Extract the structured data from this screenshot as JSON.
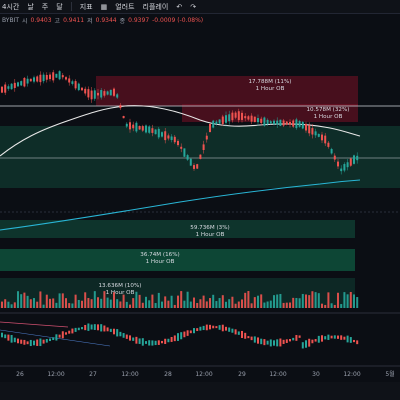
{
  "toolbar": {
    "interval": "4시간",
    "items": [
      "날",
      "주",
      "달"
    ],
    "indicators": "지표",
    "alert": "얼러트",
    "replay": "리플레이"
  },
  "symbol_info": {
    "exchange": "BYBIT",
    "open_label": "시",
    "open_value": "0.9403",
    "high_label": "고",
    "high_value": "0.9411",
    "low_label": "저",
    "low_value": "0.9344",
    "close_label": "종",
    "close_value": "0.9397",
    "change": "-0.0009 (-0.08%)"
  },
  "zones": [
    {
      "volume": "17.788M (11%)",
      "timeframe": "1 Hour OB",
      "color": "#b0223a"
    },
    {
      "volume": "10.578M (32%)",
      "timeframe": "1 Hour OB",
      "color": "#b0223a"
    },
    {
      "volume": "59.736M (3%)",
      "timeframe": "1 Hour OB",
      "color": "#0f4a3a"
    },
    {
      "volume": "36.74M (16%)",
      "timeframe": "1 Hour OB",
      "color": "#10694a"
    },
    {
      "volume": "13.636M (10%)",
      "timeframe": "1 Hour OB",
      "color": "#0f4a3a"
    }
  ],
  "x_axis": [
    "26",
    "12:00",
    "27",
    "12:00",
    "28",
    "12:00",
    "29",
    "12:00",
    "30",
    "12:00",
    "5월"
  ],
  "colors": {
    "bull": "#26a69a",
    "bear": "#ef5350",
    "ma_white": "#e8e8e8",
    "ma_cyan": "#29b6d6",
    "background": "#0b0e14"
  }
}
